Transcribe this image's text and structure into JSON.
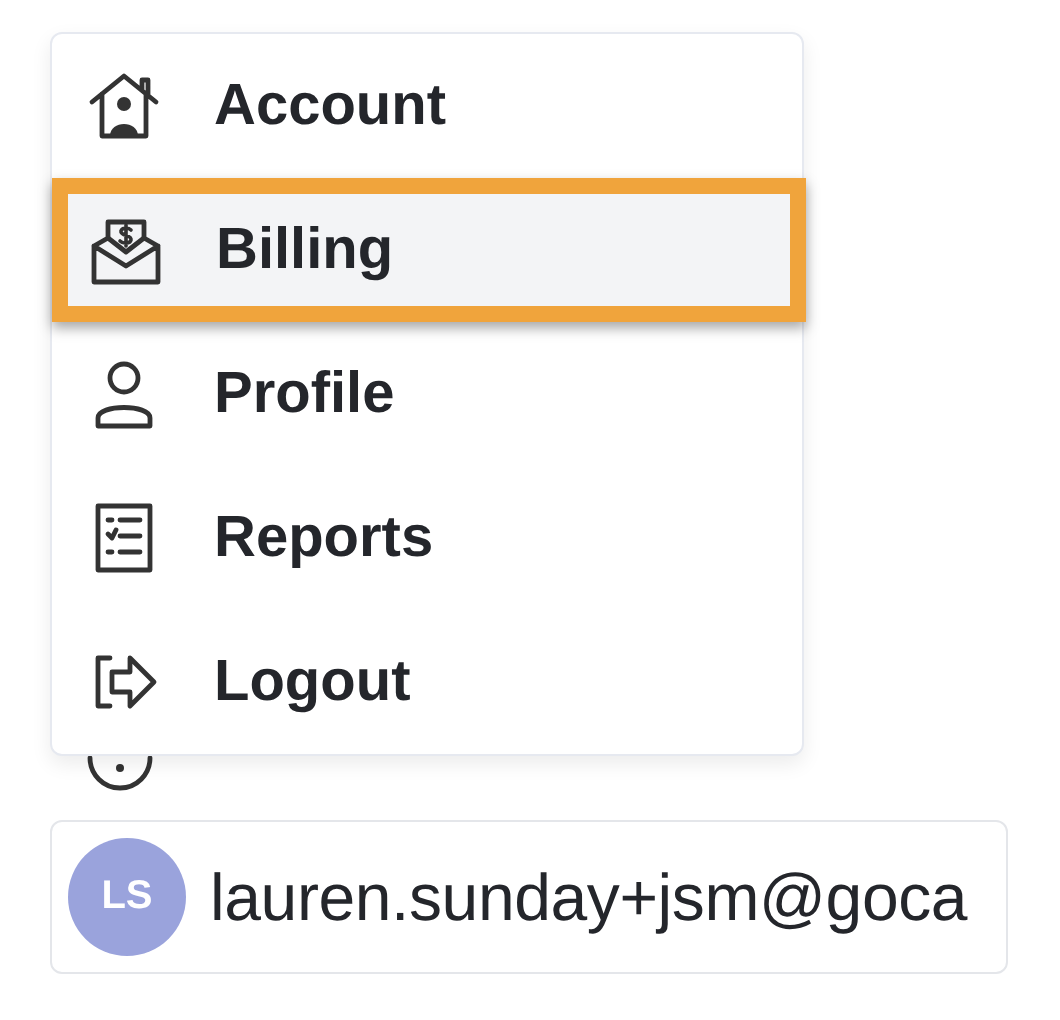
{
  "menu": {
    "items": [
      {
        "label": "Account",
        "kind": "account",
        "selected": false
      },
      {
        "label": "Billing",
        "kind": "billing",
        "selected": true
      },
      {
        "label": "Profile",
        "kind": "profile",
        "selected": false
      },
      {
        "label": "Reports",
        "kind": "reports",
        "selected": false
      },
      {
        "label": "Logout",
        "kind": "logout",
        "selected": false
      }
    ]
  },
  "user": {
    "initials": "LS",
    "email": "lauren.sunday+jsm@goca"
  }
}
